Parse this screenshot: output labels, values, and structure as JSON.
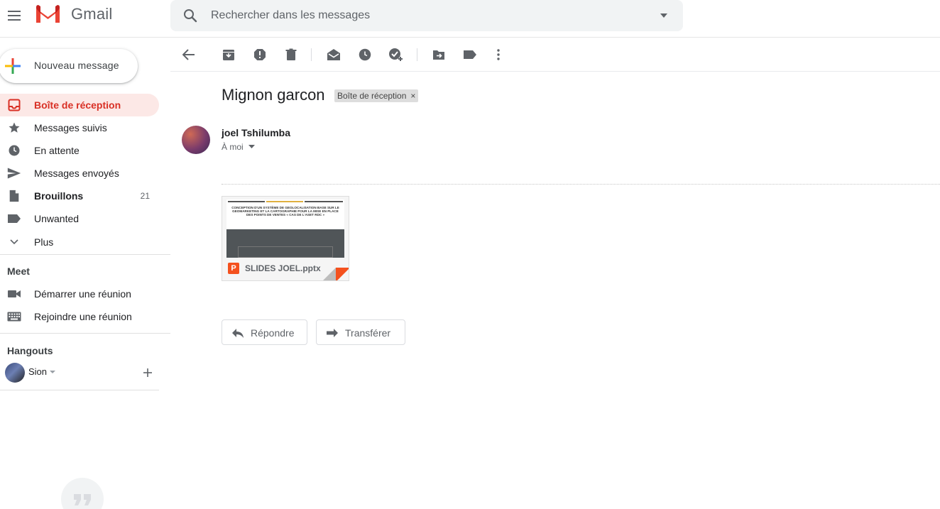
{
  "header": {
    "app_name": "Gmail",
    "search": {
      "placeholder": "Rechercher dans les messages",
      "value": ""
    }
  },
  "compose": {
    "label": "Nouveau message"
  },
  "sidebar": {
    "items": [
      {
        "label": "Boîte de réception",
        "icon": "inbox-icon",
        "active": true,
        "count": ""
      },
      {
        "label": "Messages suivis",
        "icon": "star-icon",
        "active": false,
        "count": ""
      },
      {
        "label": "En attente",
        "icon": "clock-icon",
        "active": false,
        "count": ""
      },
      {
        "label": "Messages envoyés",
        "icon": "send-icon",
        "active": false,
        "count": ""
      },
      {
        "label": "Brouillons",
        "icon": "draft-icon",
        "active": false,
        "count": "21"
      },
      {
        "label": "Unwanted",
        "icon": "label-icon",
        "active": false,
        "count": ""
      },
      {
        "label": "Plus",
        "icon": "chevron-down-icon",
        "active": false,
        "count": ""
      }
    ],
    "meet": {
      "title": "Meet",
      "items": [
        {
          "label": "Démarrer une réunion",
          "icon": "video-icon"
        },
        {
          "label": "Rejoindre une réunion",
          "icon": "keyboard-icon"
        }
      ]
    },
    "hangouts": {
      "title": "Hangouts",
      "user": "Sion"
    }
  },
  "toolbar": {
    "buttons": [
      "back-icon",
      "archive-icon",
      "report-spam-icon",
      "delete-icon",
      "mark-unread-icon",
      "snooze-icon",
      "add-to-tasks-icon",
      "move-to-icon",
      "labels-icon",
      "more-icon"
    ]
  },
  "message": {
    "subject": "Mignon garcon",
    "label_chip": "Boîte de réception",
    "label_chip_close": "×",
    "sender": "joel Tshilumba",
    "recipient": "À moi",
    "attachment": {
      "filename": "SLIDES JOEL.pptx",
      "type_letter": "P",
      "preview_title": "CONCEPTION D'UN SYSTÈME DE GEOLOCALISATION BASE SUR LE GEOMARKETING ET LA CARTOGRAPHIE POUR LA MISE EN PLACE DES POINTS DE VENTES « CAS DE L'ASET RDC »",
      "preview_subtitle": "",
      "preview_footer": ""
    },
    "reply_label": "Répondre",
    "forward_label": "Transférer"
  },
  "colors": {
    "accent_red": "#d93025",
    "active_bg": "#fce8e6",
    "ppt_orange": "#f4511e"
  }
}
